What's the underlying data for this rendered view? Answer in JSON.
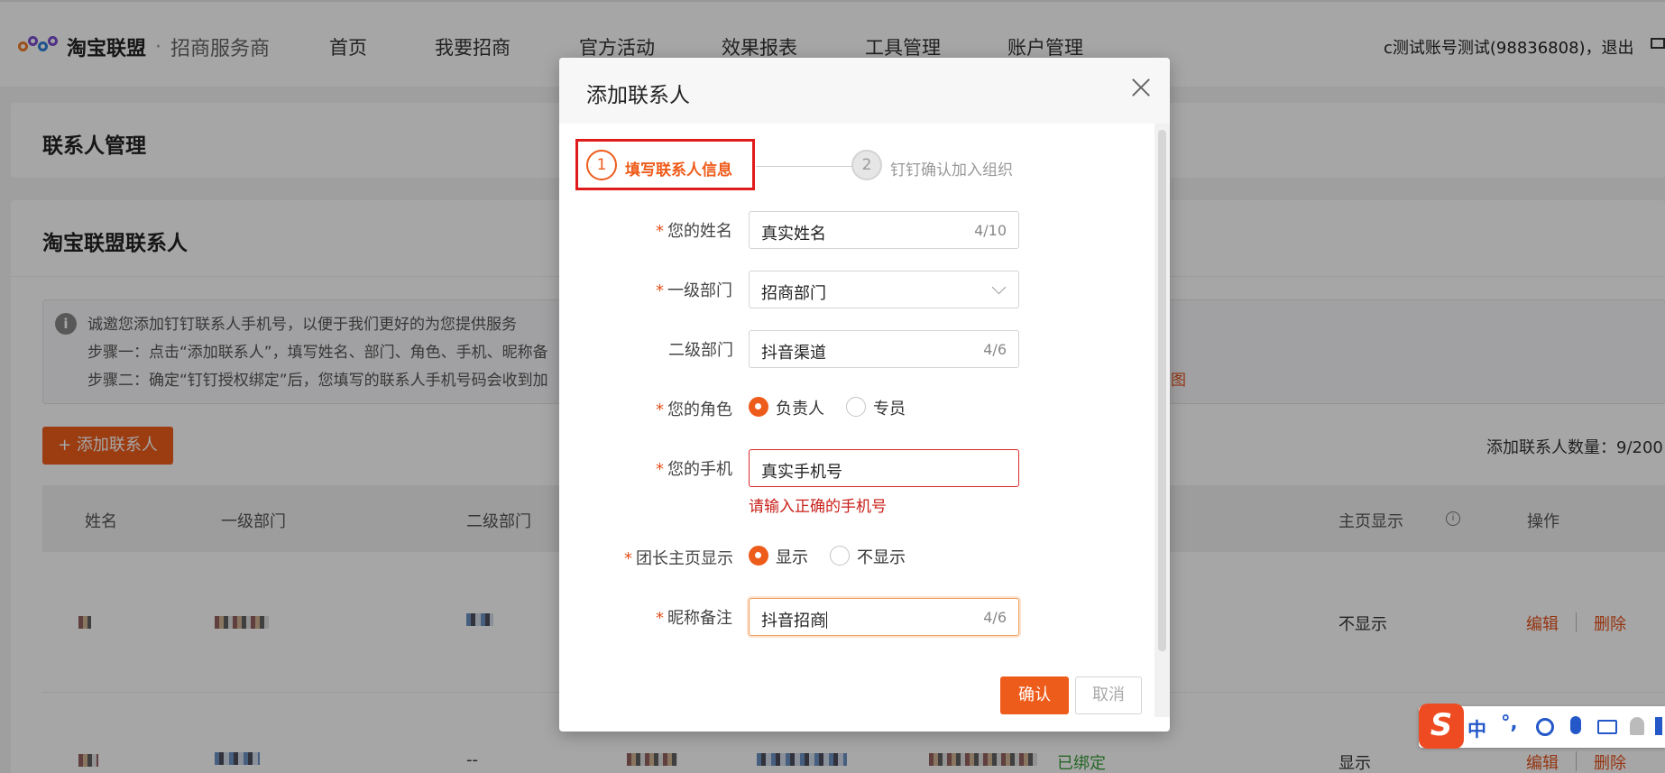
{
  "nav": {
    "brand": "淘宝联盟",
    "brand_sep": "·",
    "brand_sub": "招商服务商",
    "items": [
      "首页",
      "我要招商",
      "官方活动",
      "效果报表",
      "工具管理",
      "账户管理"
    ],
    "user": "c测试账号测试(98836808)，退出"
  },
  "page": {
    "title": "联系人管理",
    "section_title": "淘宝联盟联系人",
    "notice_lines": [
      "诚邀您添加钉钉联系人手机号，以便于我们更好的为您提供服务",
      "步骤一：点击“添加联系人”，填写姓名、部门、角色、手机、昵称备",
      "步骤二：确定“钉钉授权绑定”后，您填写的联系人手机号码会收到加"
    ],
    "notice_link": "图",
    "add_button": "+ 添加联系人",
    "count_text": "添加联系人数量：9/200",
    "table": {
      "headers": [
        "姓名",
        "一级部门",
        "二级部门",
        "主页显示",
        "操作"
      ],
      "rows": [
        {
          "home_display": "不显示",
          "edit": "编辑",
          "delete": "删除"
        },
        {
          "second_dept": "--",
          "bind_text": "已绑定",
          "home_display": "显示",
          "edit": "编辑",
          "delete": "删除"
        }
      ]
    }
  },
  "modal": {
    "title": "添加联系人",
    "steps": [
      {
        "num": "1",
        "label": "填写联系人信息"
      },
      {
        "num": "2",
        "label": "钉钉确认加入组织"
      }
    ],
    "fields": {
      "name": {
        "label": "您的姓名",
        "value": "真实姓名",
        "count": "4/10"
      },
      "dept1": {
        "label": "一级部门",
        "value": "招商部门"
      },
      "dept2": {
        "label": "二级部门",
        "value": "抖音渠道",
        "count": "4/6"
      },
      "role": {
        "label": "您的角色",
        "options": [
          "负责人",
          "专员"
        ],
        "selected": "负责人"
      },
      "phone": {
        "label": "您的手机",
        "value": "真实手机号",
        "error": "请输入正确的手机号"
      },
      "home": {
        "label": "团长主页显示",
        "options": [
          "显示",
          "不显示"
        ],
        "selected": "显示"
      },
      "nickname": {
        "label": "昵称备注",
        "value": "抖音招商",
        "count": "4/6"
      }
    },
    "required_mark": "*",
    "confirm": "确认",
    "cancel": "取消"
  },
  "ime": {
    "logo": "S",
    "mode": "中",
    "punct": "°,"
  },
  "colors": {
    "accent": "#ee5c1b",
    "error": "#c8201a",
    "step_highlight": "#e01b1b"
  }
}
